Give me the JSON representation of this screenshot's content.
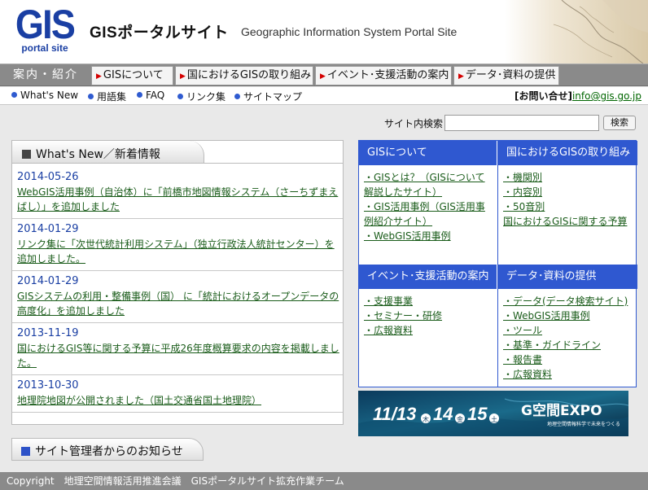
{
  "header": {
    "logo_text": "GIS",
    "logo_sub": "portal site",
    "title": "GISポータルサイト",
    "subtitle": "Geographic Information System Portal Site"
  },
  "nav": {
    "intro": "案内・紹介",
    "tabs": [
      {
        "label": "GISについて"
      },
      {
        "label": "国におけるGISの取り組み"
      },
      {
        "label": "イベント･支援活動の案内"
      },
      {
        "label": "データ･資料の提供"
      }
    ]
  },
  "subnav": {
    "links": [
      {
        "label": "What's New"
      },
      {
        "label": "用語集"
      },
      {
        "label": "FAQ"
      },
      {
        "label": "リンク集"
      },
      {
        "label": "サイトマップ"
      }
    ],
    "contact_label": "[お問い合せ]",
    "contact_email": "info@gis.go.jp"
  },
  "search": {
    "label": "サイト内検索",
    "input_value": "",
    "button_label": "検索"
  },
  "news": {
    "title": "What's New／新着情報",
    "items": [
      {
        "date": "2014-05-26",
        "text": "WebGIS活用事例（自治体）に「前橋市地図情報システム（さーちずまえばし）」を追加しました"
      },
      {
        "date": "2014-01-29",
        "text": "リンク集に「次世代統計利用システム」（独立行政法人統計センター）を追加しました。"
      },
      {
        "date": "2014-01-29",
        "text": "GISシステムの利用・整備事例（国） に「統計におけるオープンデータの高度化」を追加しました"
      },
      {
        "date": "2013-11-19",
        "text": "国におけるGIS等に関する予算に平成26年度概算要求の内容を掲載しました。"
      },
      {
        "date": "2013-10-30",
        "text": "地理院地図が公開されました（国土交通省国土地理院）"
      }
    ]
  },
  "admin_notice": {
    "title": "サイト管理者からのお知らせ"
  },
  "grid": {
    "cells": [
      {
        "title": "GISについて",
        "links": [
          "・GISとは？（GISについて解説したサイト）",
          "・GIS活用事例（GIS活用事例紹介サイト）",
          "・WebGIS活用事例"
        ]
      },
      {
        "title": "国におけるGISの取り組み",
        "links": [
          "・機関別",
          "・内容別",
          "・50音別",
          "国におけるGISに関する予算"
        ]
      },
      {
        "title": "イベント･支援活動の案内",
        "links": [
          "・支援事業",
          "・セミナー・研修",
          "・広報資料"
        ]
      },
      {
        "title": "データ･資料の提供",
        "links": [
          "・データ(データ検索サイト)",
          "・WebGIS活用事例",
          "・ツール",
          "・基準・ガイドライン",
          "・報告書",
          "・広報資料"
        ]
      }
    ]
  },
  "banner": {
    "date_text": "11/13",
    "day1": "木",
    "date2": "14",
    "day2": "金",
    "date3": "15",
    "day3": "土",
    "expo_text": "G空間EXPO",
    "expo_tagline": "地理空間情報科学で未来をつくる"
  },
  "footer": {
    "text": "Copyright　地理空間情報活用推進会議　GISポータルサイト拡充作業チーム"
  },
  "colors": {
    "brand_blue": "#1a3fa3",
    "grid_blue": "#2f58d0",
    "link_green": "#1a5c1a",
    "nav_gray": "#8a8a8a"
  }
}
